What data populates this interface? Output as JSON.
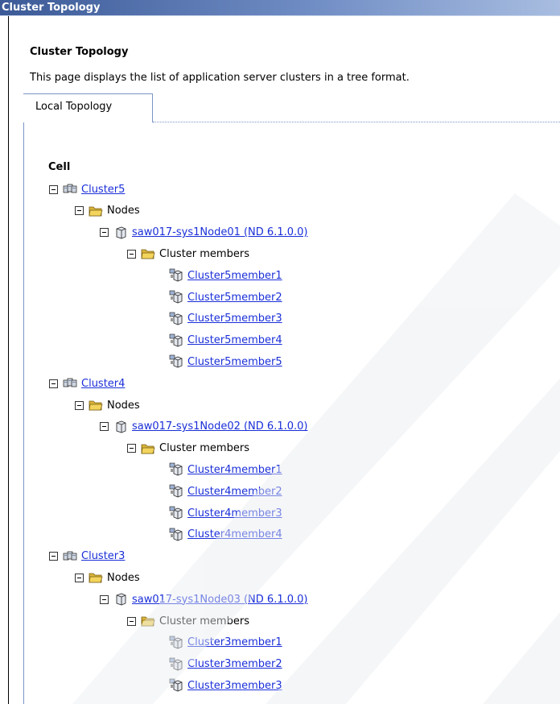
{
  "window": {
    "title": "Cluster Topology"
  },
  "page": {
    "heading": "Cluster Topology",
    "description": "This page displays the list of application server clusters in a tree format."
  },
  "tabs": [
    {
      "label": "Local Topology",
      "active": true
    }
  ],
  "tree": {
    "root_label": "Cell",
    "clusters": [
      {
        "name": "Cluster5",
        "nodes_label": "Nodes",
        "node": {
          "name": "saw017-sys1Node01 (ND 6.1.0.0)"
        },
        "members_label": "Cluster members",
        "members": [
          "Cluster5member1",
          "Cluster5member2",
          "Cluster5member3",
          "Cluster5member4",
          "Cluster5member5"
        ]
      },
      {
        "name": "Cluster4",
        "nodes_label": "Nodes",
        "node": {
          "name": "saw017-sys1Node02 (ND 6.1.0.0)"
        },
        "members_label": "Cluster members",
        "members": [
          "Cluster4member1",
          "Cluster4member2",
          "Cluster4member3",
          "Cluster4member4"
        ]
      },
      {
        "name": "Cluster3",
        "nodes_label": "Nodes",
        "node": {
          "name": "saw017-sys1Node03 (ND 6.1.0.0)"
        },
        "members_label": "Cluster members",
        "members": [
          "Cluster3member1",
          "Cluster3member2",
          "Cluster3member3"
        ]
      }
    ]
  },
  "colors": {
    "title_bar": "#4a6aa6",
    "link": "#1a2fd8",
    "tab_border": "#7b94c8",
    "folder": "#e8c64a"
  },
  "icons": {
    "cluster": "cluster-icon",
    "folder": "folder-open-icon",
    "node": "node-icon",
    "member": "server-member-icon",
    "toggle": "collapse-icon"
  }
}
